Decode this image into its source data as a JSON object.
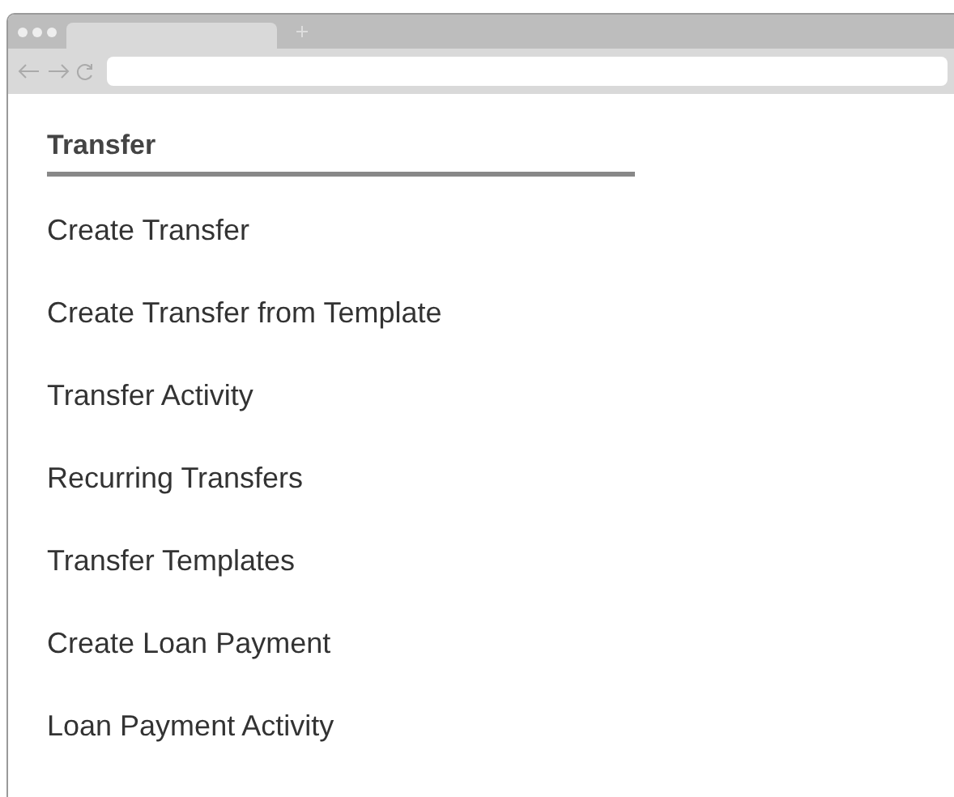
{
  "menu": {
    "title": "Transfer",
    "items": [
      {
        "label": "Create Transfer"
      },
      {
        "label": "Create Transfer from Template"
      },
      {
        "label": "Transfer Activity"
      },
      {
        "label": "Recurring Transfers"
      },
      {
        "label": "Transfer Templates"
      },
      {
        "label": "Create Loan Payment"
      },
      {
        "label": "Loan Payment Activity"
      }
    ]
  }
}
